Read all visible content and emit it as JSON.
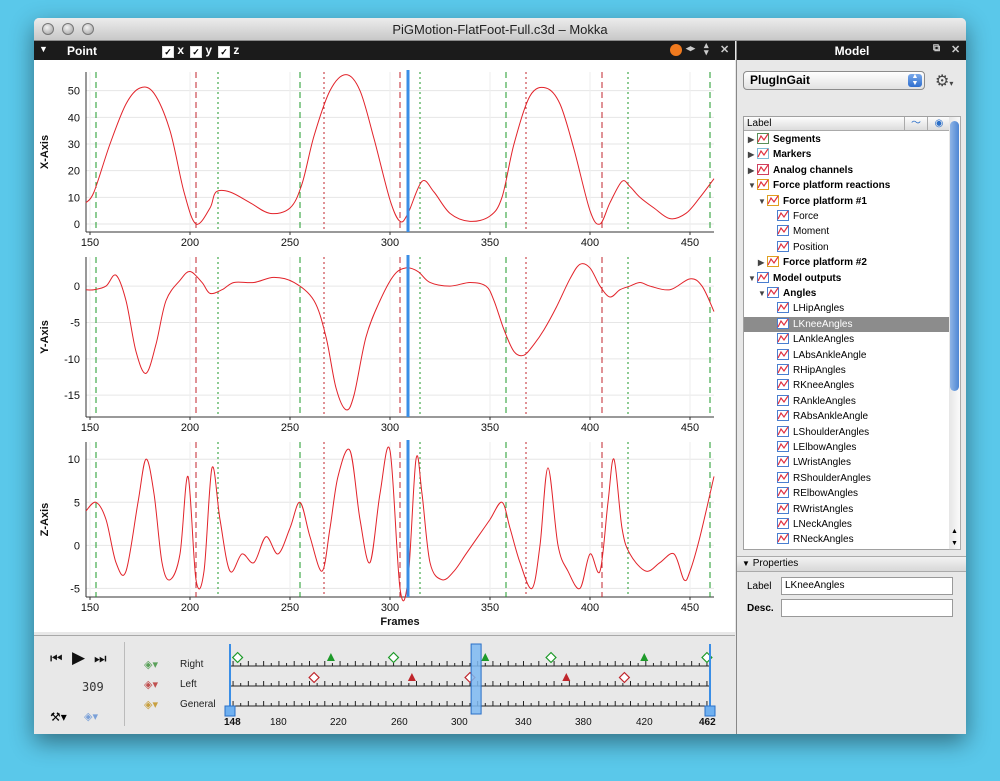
{
  "window": {
    "title": "PiGMotion-FlatFoot-Full.c3d – Mokka"
  },
  "left_pane": {
    "title": "Point",
    "checkboxes": [
      {
        "label": "x",
        "checked": true
      },
      {
        "label": "y",
        "checked": true
      },
      {
        "label": "z",
        "checked": true
      }
    ],
    "header_icons": [
      "orange-options-icon",
      "horizontal-split-icon",
      "vertical-split-icon",
      "close-icon"
    ]
  },
  "right_pane": {
    "title": "Model",
    "header_icons": [
      "detach-icon",
      "close-icon"
    ],
    "model_select": "PlugInGait",
    "tree_header": "Label",
    "tree_header_icons": [
      "visibility-curve-icon",
      "eye-icon"
    ],
    "tree_items": [
      {
        "label": "Segments",
        "depth": 0,
        "bold": true,
        "expanded": false,
        "icon": "segment-icon"
      },
      {
        "label": "Markers",
        "depth": 0,
        "bold": true,
        "expanded": false,
        "icon": "marker-icon"
      },
      {
        "label": "Analog channels",
        "depth": 0,
        "bold": true,
        "expanded": false,
        "icon": "analog-icon"
      },
      {
        "label": "Force platform reactions",
        "depth": 0,
        "bold": true,
        "expanded": true,
        "icon": "force-platform-icon"
      },
      {
        "label": "Force platform #1",
        "depth": 1,
        "bold": true,
        "expanded": true,
        "icon": "force-platform-icon"
      },
      {
        "label": "Force",
        "depth": 2,
        "bold": false,
        "icon": "chart-icon"
      },
      {
        "label": "Moment",
        "depth": 2,
        "bold": false,
        "icon": "chart-icon"
      },
      {
        "label": "Position",
        "depth": 2,
        "bold": false,
        "icon": "chart-icon"
      },
      {
        "label": "Force platform #2",
        "depth": 1,
        "bold": true,
        "expanded": false,
        "icon": "force-platform-icon"
      },
      {
        "label": "Model outputs",
        "depth": 0,
        "bold": true,
        "expanded": true,
        "icon": "chart-icon"
      },
      {
        "label": "Angles",
        "depth": 1,
        "bold": true,
        "expanded": true,
        "icon": "chart-icon"
      },
      {
        "label": "LHipAngles",
        "depth": 2,
        "bold": false,
        "icon": "chart-icon"
      },
      {
        "label": "LKneeAngles",
        "depth": 2,
        "bold": false,
        "selected": true,
        "icon": "chart-icon"
      },
      {
        "label": "LAnkleAngles",
        "depth": 2,
        "bold": false,
        "icon": "chart-icon"
      },
      {
        "label": "LAbsAnkleAngle",
        "depth": 2,
        "bold": false,
        "icon": "chart-icon"
      },
      {
        "label": "RHipAngles",
        "depth": 2,
        "bold": false,
        "icon": "chart-icon"
      },
      {
        "label": "RKneeAngles",
        "depth": 2,
        "bold": false,
        "icon": "chart-icon"
      },
      {
        "label": "RAnkleAngles",
        "depth": 2,
        "bold": false,
        "icon": "chart-icon"
      },
      {
        "label": "RAbsAnkleAngle",
        "depth": 2,
        "bold": false,
        "icon": "chart-icon"
      },
      {
        "label": "LShoulderAngles",
        "depth": 2,
        "bold": false,
        "icon": "chart-icon"
      },
      {
        "label": "LElbowAngles",
        "depth": 2,
        "bold": false,
        "icon": "chart-icon"
      },
      {
        "label": "LWristAngles",
        "depth": 2,
        "bold": false,
        "icon": "chart-icon"
      },
      {
        "label": "RShoulderAngles",
        "depth": 2,
        "bold": false,
        "icon": "chart-icon"
      },
      {
        "label": "RElbowAngles",
        "depth": 2,
        "bold": false,
        "icon": "chart-icon"
      },
      {
        "label": "RWristAngles",
        "depth": 2,
        "bold": false,
        "icon": "chart-icon"
      },
      {
        "label": "LNeckAngles",
        "depth": 2,
        "bold": false,
        "icon": "chart-icon"
      },
      {
        "label": "RNeckAngles",
        "depth": 2,
        "bold": false,
        "icon": "chart-icon"
      }
    ],
    "properties": {
      "title": "Properties",
      "label_caption": "Label",
      "label_value": "LKneeAngles",
      "desc_caption": "Desc.",
      "desc_value": ""
    }
  },
  "timeline": {
    "current_frame": "309",
    "rows": [
      "Right",
      "Left",
      "General"
    ],
    "start_label": "148",
    "end_label": "462",
    "tick_labels": [
      "180",
      "220",
      "260",
      "300",
      "340",
      "380",
      "420"
    ],
    "range": [
      148,
      462
    ],
    "cursor": 309,
    "events": {
      "Right": [
        {
          "frame": 153,
          "type": "foot-off"
        },
        {
          "frame": 214,
          "type": "foot-strike"
        },
        {
          "frame": 255,
          "type": "foot-off"
        },
        {
          "frame": 315,
          "type": "foot-strike"
        },
        {
          "frame": 358,
          "type": "foot-off"
        },
        {
          "frame": 419,
          "type": "foot-strike"
        },
        {
          "frame": 460,
          "type": "foot-off"
        }
      ],
      "Left": [
        {
          "frame": 203,
          "type": "foot-off"
        },
        {
          "frame": 267,
          "type": "foot-strike"
        },
        {
          "frame": 305,
          "type": "foot-off"
        },
        {
          "frame": 368,
          "type": "foot-strike"
        },
        {
          "frame": 406,
          "type": "foot-off"
        }
      ]
    }
  },
  "colors": {
    "curve": "#e2232a",
    "cursor": "#3a8ee6",
    "right_event": "#1e9a2a",
    "left_event": "#c0262c"
  },
  "chart_data": [
    {
      "type": "line",
      "ylabel": "X-Axis",
      "xlim": [
        148,
        462
      ],
      "ylim": [
        -3,
        57
      ],
      "yticks": [
        0,
        10,
        20,
        30,
        40,
        50
      ],
      "xticks": [
        150,
        200,
        250,
        300,
        350,
        400,
        450
      ],
      "x": [
        148,
        152,
        160,
        168,
        175,
        182,
        190,
        197,
        203,
        210,
        213,
        220,
        230,
        240,
        250,
        256,
        262,
        270,
        278,
        285,
        292,
        300,
        305,
        309,
        316,
        322,
        330,
        340,
        350,
        356,
        362,
        370,
        378,
        385,
        392,
        400,
        405,
        410,
        416,
        420,
        425,
        432,
        440,
        448,
        455,
        462
      ],
      "y": [
        8,
        12,
        30,
        45,
        51,
        49,
        35,
        12,
        0,
        6,
        12,
        12,
        8,
        4,
        6,
        15,
        33,
        50,
        56,
        50,
        32,
        9,
        1,
        4,
        16,
        12,
        4,
        1,
        3,
        10,
        30,
        48,
        51,
        45,
        28,
        5,
        0,
        8,
        16,
        14,
        10,
        6,
        2,
        4,
        10,
        17
      ]
    },
    {
      "type": "line",
      "ylabel": "Y-Axis",
      "xlim": [
        148,
        462
      ],
      "ylim": [
        -18,
        4
      ],
      "yticks": [
        -15,
        -10,
        -5,
        0
      ],
      "xticks": [
        150,
        200,
        250,
        300,
        350,
        400,
        450
      ],
      "x": [
        148,
        152,
        158,
        163,
        168,
        173,
        178,
        183,
        188,
        195,
        200,
        206,
        210,
        216,
        222,
        232,
        242,
        252,
        262,
        268,
        273,
        278,
        282,
        288,
        295,
        302,
        308,
        314,
        320,
        330,
        340,
        348,
        352,
        357,
        362,
        367,
        372,
        377,
        383,
        390,
        395,
        400,
        405,
        410,
        415,
        420,
        425,
        430,
        440,
        450,
        456,
        462
      ],
      "y": [
        -0.5,
        -0.5,
        0,
        1.5,
        -2,
        -9,
        -12,
        -8,
        -2,
        0.8,
        2,
        0.5,
        -1,
        -0.5,
        0.5,
        0.5,
        1.2,
        0.5,
        -2,
        -7,
        -14,
        -17,
        -15,
        -7,
        -2,
        1.5,
        2.5,
        2,
        0.5,
        0,
        0.5,
        0,
        -2,
        -6,
        -9,
        -9.5,
        -8,
        -6,
        -3,
        1,
        3,
        2.5,
        0,
        -1.5,
        -0.5,
        0,
        0.5,
        0,
        -0.5,
        1,
        0,
        -3.5
      ]
    },
    {
      "type": "line",
      "ylabel": "Z-Axis",
      "xlim": [
        148,
        462
      ],
      "xlabel": "Frames",
      "ylim": [
        -6,
        12
      ],
      "yticks": [
        -5,
        0,
        5,
        10
      ],
      "xticks": [
        150,
        200,
        250,
        300,
        350,
        400,
        450
      ],
      "x": [
        148,
        153,
        158,
        163,
        168,
        174,
        178,
        182,
        186,
        190,
        195,
        199,
        203,
        207,
        211,
        215,
        220,
        226,
        232,
        238,
        244,
        250,
        255,
        260,
        266,
        270,
        274,
        280,
        285,
        290,
        295,
        300,
        305,
        309,
        313,
        316,
        320,
        326,
        332,
        338,
        344,
        350,
        356,
        360,
        365,
        371,
        375,
        379,
        384,
        389,
        395,
        400,
        405,
        409,
        412,
        416,
        420,
        428,
        435,
        442,
        447,
        450,
        455,
        462
      ],
      "y": [
        4,
        5,
        3,
        -2,
        -3,
        5,
        10,
        6,
        -2,
        -4,
        -1,
        8,
        -4,
        -3,
        9,
        3,
        -3,
        -1,
        -2,
        1,
        -1,
        2,
        5,
        1,
        -3,
        2,
        8,
        11,
        3,
        -2,
        6,
        11,
        -5,
        -4,
        10,
        6,
        -2,
        -4,
        -3,
        -1,
        1,
        3,
        5,
        2,
        -2,
        -5,
        0,
        9,
        0,
        -3,
        -5,
        -1,
        -3,
        5,
        10,
        2,
        -1,
        -3,
        -2,
        -1,
        -4,
        -3,
        1,
        8
      ]
    }
  ]
}
